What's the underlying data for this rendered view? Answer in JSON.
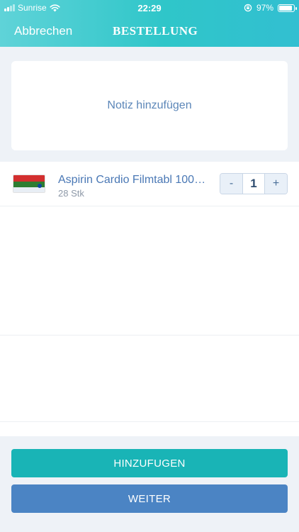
{
  "status_bar": {
    "carrier": "Sunrise",
    "time": "22:29",
    "battery": "97%",
    "battery_level": 0.97
  },
  "nav": {
    "cancel_label": "Abbrechen",
    "title": "BESTELLUNG"
  },
  "note": {
    "label": "Notiz hinzufügen"
  },
  "items": [
    {
      "name": "Aspirin Cardio Filmtabl 100…",
      "quantity_label": "28 Stk",
      "count": "1",
      "decrement_label": "-",
      "increment_label": "+"
    }
  ],
  "buttons": {
    "add_label": "HINZUFUGEN",
    "next_label": "WEITER"
  },
  "colors": {
    "header": "#2fc6c9",
    "accent_teal": "#19b4b6",
    "accent_blue": "#4b84c4",
    "link_blue": "#4a78b5"
  }
}
